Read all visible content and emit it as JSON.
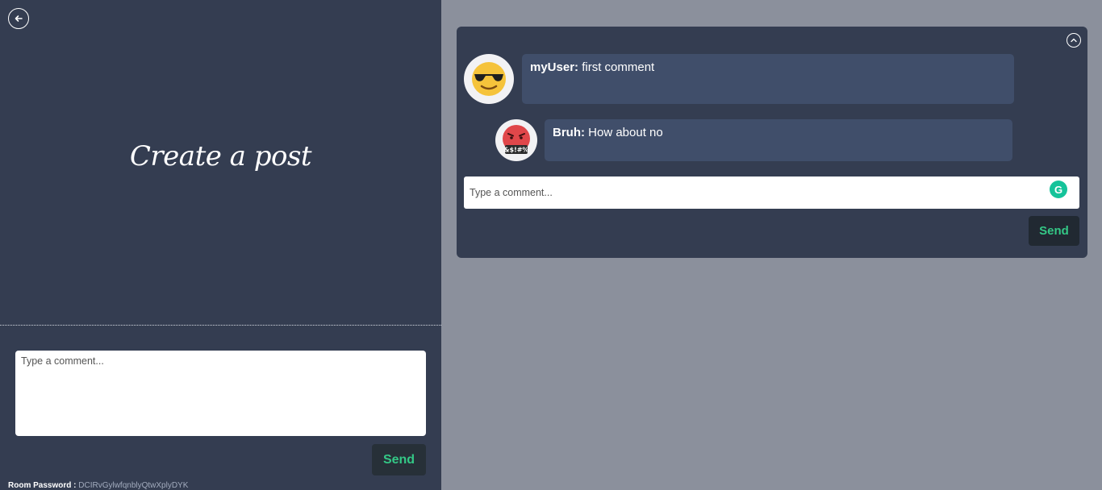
{
  "left_panel": {
    "title": "Create a post",
    "post_input": {
      "placeholder": "Type a comment...",
      "value": ""
    },
    "send_label": "Send",
    "room_password_label": "Room Password : ",
    "room_password_value": "DCIRvGylwfqnblyQtwXplyDYK"
  },
  "comments": {
    "items": [
      {
        "author": "myUser:",
        "text": " first comment",
        "avatar_icon": "sunglasses-face-emoji"
      },
      {
        "author": "Bruh:",
        "text": " How about no",
        "avatar_icon": "cursing-face-emoji"
      }
    ],
    "reply_input": {
      "placeholder": "Type a comment...",
      "value": ""
    },
    "grammarly_icon": "G",
    "send_label": "Send"
  },
  "colors": {
    "panel": "#343d51",
    "page_bg": "#8b909c",
    "bubble": "#404e6a",
    "accent_green": "#34c886"
  }
}
